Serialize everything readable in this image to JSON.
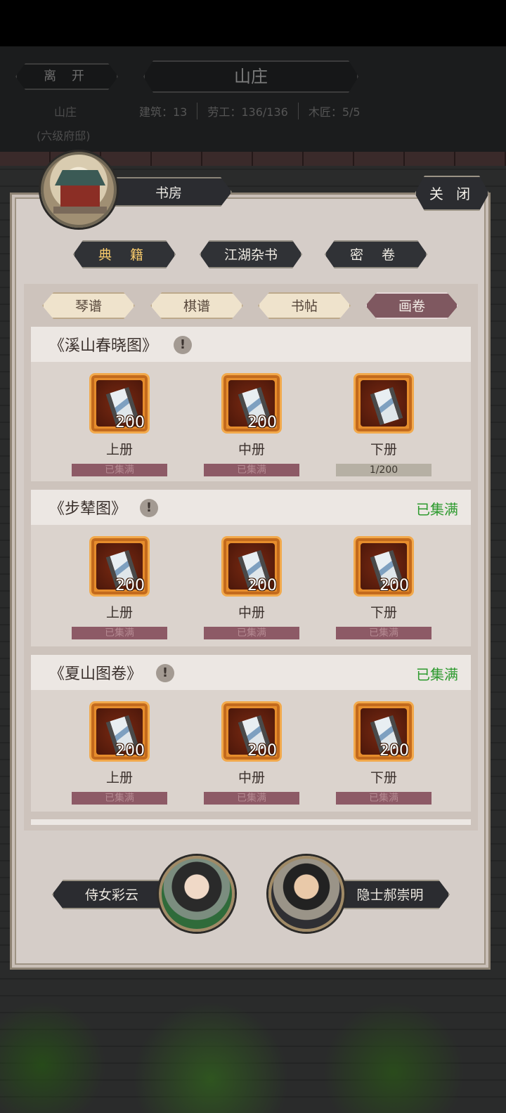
{
  "top": {
    "leave_label": "离 开",
    "title": "山庄",
    "location_name": "山庄",
    "location_rank": "(六级府邸)",
    "stats": {
      "buildings": "建筑：13",
      "labor": "劳工：136/136",
      "carpenters": "木匠：5/5"
    }
  },
  "modal": {
    "building_icon": "library-building-icon",
    "name": "书房",
    "close_label": "关 闭",
    "main_tabs": [
      {
        "label": "典 籍",
        "active": true
      },
      {
        "label": "江湖杂书",
        "active": false
      },
      {
        "label": "密 卷",
        "active": false
      }
    ],
    "sub_tabs": [
      {
        "label": "琴谱",
        "active": false
      },
      {
        "label": "棋谱",
        "active": false
      },
      {
        "label": "书帖",
        "active": false
      },
      {
        "label": "画卷",
        "active": true
      }
    ],
    "collections": [
      {
        "title": "《溪山春晓图》",
        "info_icon": "!",
        "status": "",
        "items": [
          {
            "icon": "scroll-painting-icon",
            "count": "200",
            "label": "上册",
            "progress": "已集满"
          },
          {
            "icon": "scroll-painting-icon",
            "count": "200",
            "label": "中册",
            "progress": "已集满"
          },
          {
            "icon": "scroll-painting-icon",
            "count": "",
            "label": "下册",
            "progress": "1/200"
          }
        ]
      },
      {
        "title": "《步辇图》",
        "info_icon": "!",
        "status": "已集满",
        "items": [
          {
            "icon": "scroll-painting-icon",
            "count": "200",
            "label": "上册",
            "progress": "已集满"
          },
          {
            "icon": "scroll-painting-icon",
            "count": "200",
            "label": "中册",
            "progress": "已集满"
          },
          {
            "icon": "scroll-painting-icon",
            "count": "200",
            "label": "下册",
            "progress": "已集满"
          }
        ]
      },
      {
        "title": "《夏山图卷》",
        "info_icon": "!",
        "status": "已集满",
        "items": [
          {
            "icon": "scroll-painting-icon",
            "count": "200",
            "label": "上册",
            "progress": "已集满"
          },
          {
            "icon": "scroll-painting-icon",
            "count": "200",
            "label": "中册",
            "progress": "已集满"
          },
          {
            "icon": "scroll-painting-icon",
            "count": "200",
            "label": "下册",
            "progress": "已集满"
          }
        ]
      }
    ],
    "npcs": [
      {
        "name": "侍女彩云",
        "portrait": "maid-portrait"
      },
      {
        "name": "隐士郝崇明",
        "portrait": "hermit-portrait"
      }
    ]
  },
  "colors": {
    "active_main_tab_text": "#f6c96b",
    "active_sub_tab": "#7f5860",
    "complete_text": "#2d9a2e",
    "progress_full": "#8d5a66"
  }
}
